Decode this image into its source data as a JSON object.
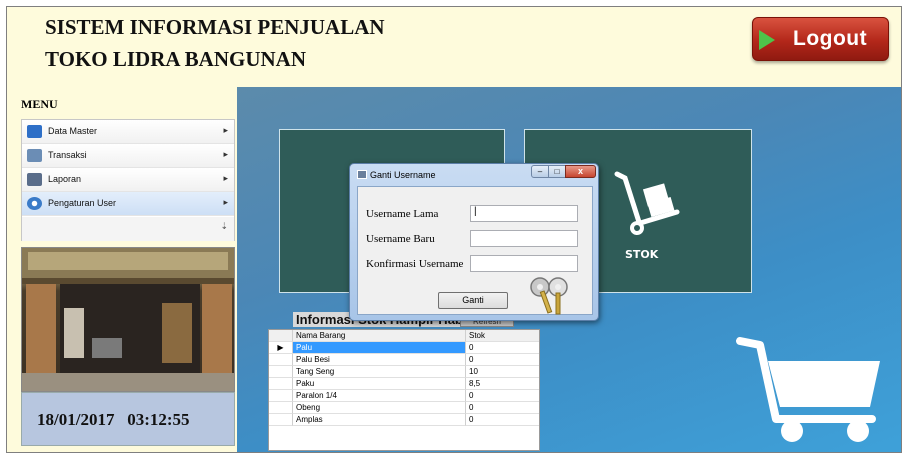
{
  "header": {
    "title_line1": "SISTEM INFORMASI PENJUALAN",
    "title_line2": "TOKO LIDRA BANGUNAN",
    "logout_label": "Logout"
  },
  "menu": {
    "title": "MENU",
    "items": [
      {
        "label": "Data Master",
        "icon": "users-icon",
        "arrow": "▸"
      },
      {
        "label": "Transaksi",
        "icon": "transaction-icon",
        "arrow": "▸"
      },
      {
        "label": "Laporan",
        "icon": "truck-icon",
        "arrow": "▸"
      },
      {
        "label": "Pengaturan User",
        "icon": "gear-icon",
        "arrow": "▸"
      }
    ],
    "scroll_glyph": "⇣"
  },
  "clock": {
    "text": "18/01/2017   03:12:55"
  },
  "tiles": {
    "stok_label": "STOK"
  },
  "stock_info": {
    "title": "Informasi Stok Hampir Habis",
    "refresh_label": "Refresh",
    "columns": [
      "Nama Barang",
      "Stok"
    ],
    "row_marker": "▶",
    "rows": [
      {
        "name": "Palu",
        "stock": "0"
      },
      {
        "name": "Palu Besi",
        "stock": "0"
      },
      {
        "name": "Tang Seng",
        "stock": "10"
      },
      {
        "name": "Paku",
        "stock": "8,5"
      },
      {
        "name": "Paralon 1/4",
        "stock": "0"
      },
      {
        "name": "Obeng",
        "stock": "0"
      },
      {
        "name": "Amplas",
        "stock": "0"
      }
    ]
  },
  "dialog": {
    "title": "Ganti Username",
    "minimize": "–",
    "maximize": "□",
    "close": "x",
    "label_old": "Username Lama",
    "label_new": "Username Baru",
    "label_confirm": "Konfirmasi Username",
    "value_old": "|",
    "value_new": "",
    "value_confirm": "",
    "button_label": "Ganti"
  },
  "colors": {
    "header_bg": "#fefbdc",
    "logout_red": "#b3271a",
    "tile_green": "#2f5c58",
    "selection_blue": "#3399ff",
    "date_box_bg": "#b7c6df"
  }
}
